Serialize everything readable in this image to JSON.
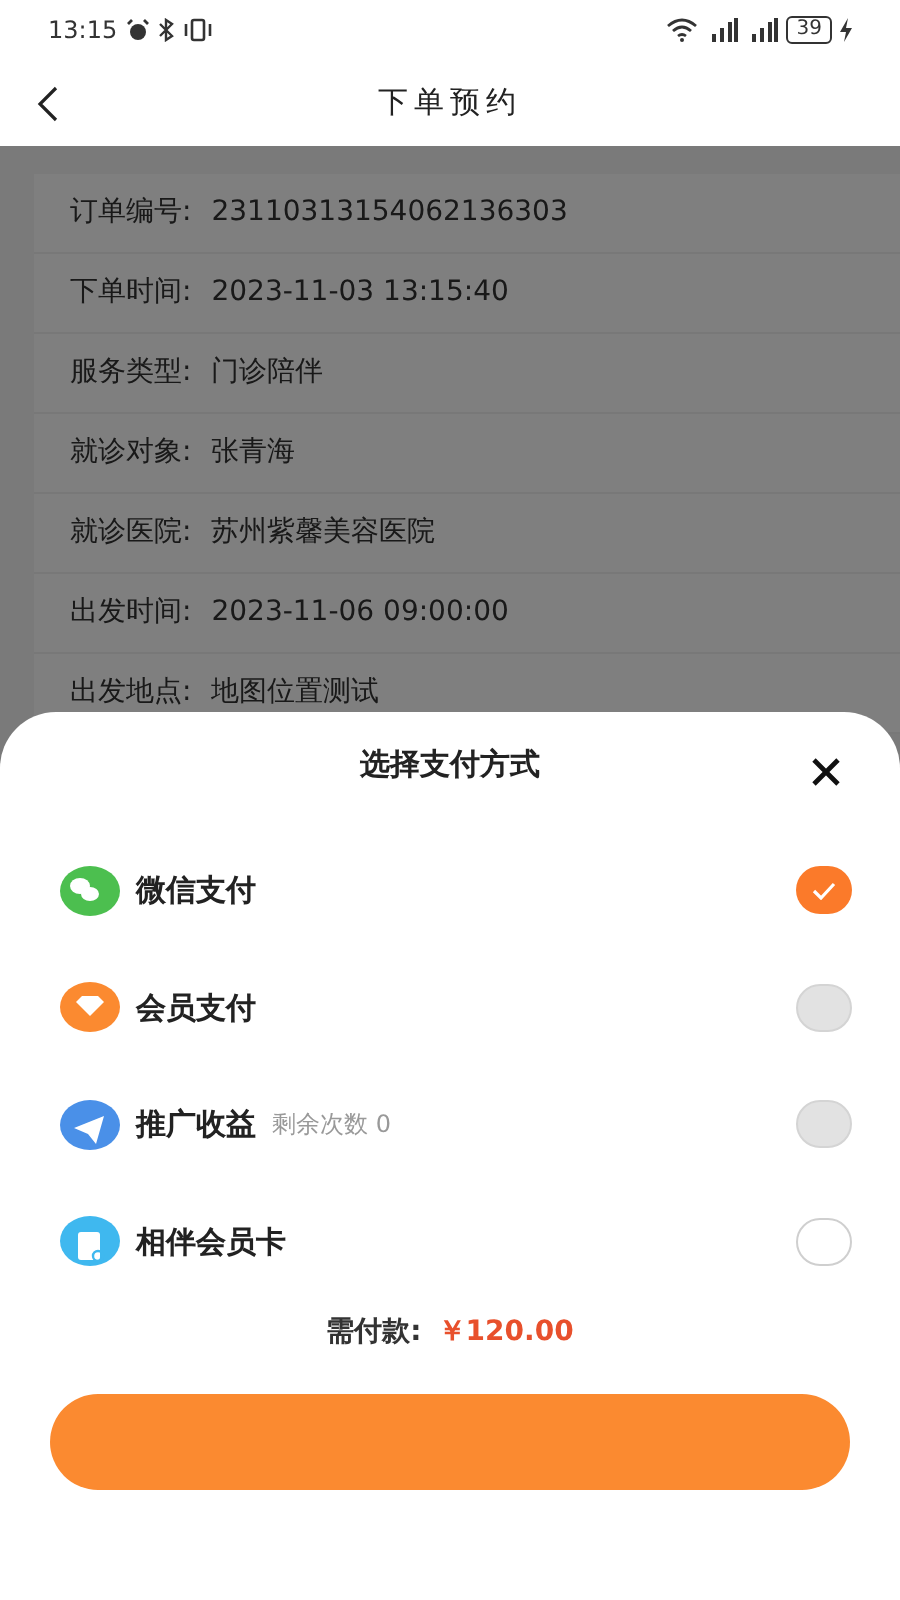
{
  "status_bar": {
    "time": "13:15",
    "battery": "39"
  },
  "header": {
    "title": "下单预约"
  },
  "order": [
    {
      "label": "订单编号:",
      "value": "23110313154062136303"
    },
    {
      "label": "下单时间:",
      "value": "2023-11-03 13:15:40"
    },
    {
      "label": "服务类型:",
      "value": "门诊陪伴"
    },
    {
      "label": "就诊对象:",
      "value": "张青海"
    },
    {
      "label": "就诊医院:",
      "value": "苏州紫馨美容医院"
    },
    {
      "label": "出发时间:",
      "value": "2023-11-06 09:00:00"
    },
    {
      "label": "出发地点:",
      "value": "地图位置测试"
    }
  ],
  "payment_sheet": {
    "title": "选择支付方式",
    "methods": [
      {
        "kind": "wechat",
        "name": "微信支付",
        "selected": true,
        "disabled": false
      },
      {
        "kind": "member",
        "name": "会员支付",
        "selected": false,
        "disabled": true
      },
      {
        "kind": "promo",
        "name": "推广收益",
        "note": "剩余次数 0",
        "selected": false,
        "disabled": true
      },
      {
        "kind": "card",
        "name": "相伴会员卡",
        "selected": false,
        "disabled": false
      }
    ],
    "amount_label": "需付款:",
    "amount": "￥120.00"
  }
}
